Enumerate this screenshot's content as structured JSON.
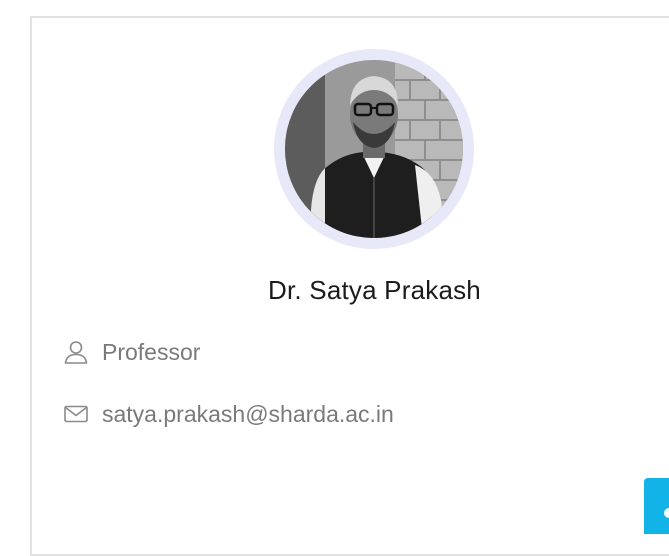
{
  "profile": {
    "name": "Dr. Satya Prakash",
    "designation": "Professor",
    "email": "satya.prakash@sharda.ac.in",
    "photo_icon": "person-photo",
    "designation_icon": "user-icon",
    "email_icon": "mail-icon"
  },
  "floating_tab": {
    "icon": "chat-icon",
    "color": "#12b3e6"
  },
  "colors": {
    "ring": "#e7e9f8",
    "text_muted": "#7a7a7a",
    "name_text": "#1b1b1b"
  }
}
